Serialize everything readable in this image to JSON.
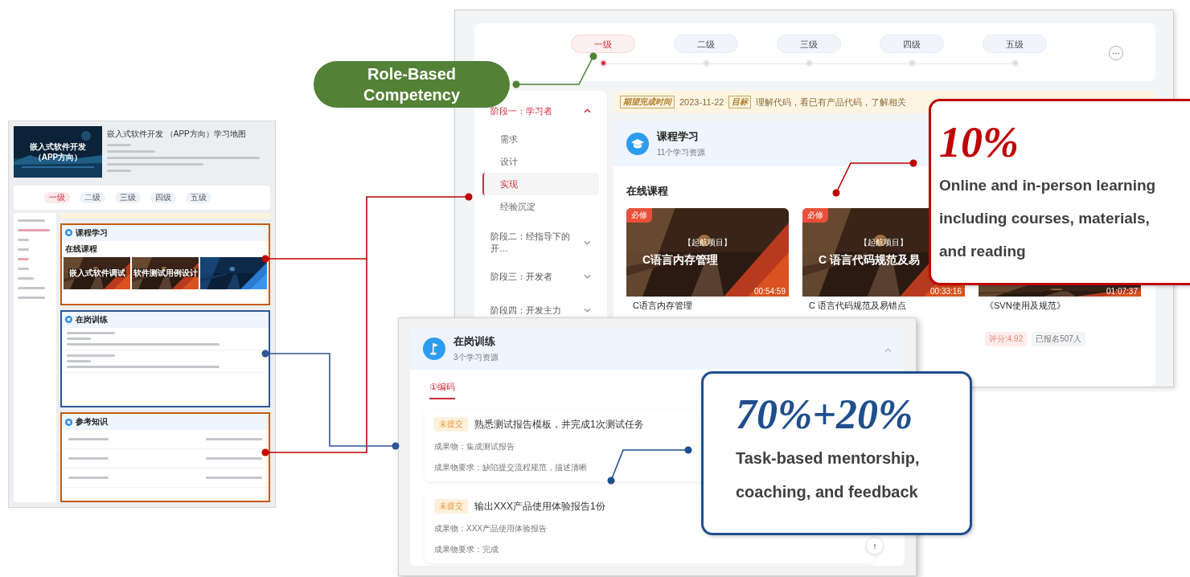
{
  "thumbnail": {
    "banner": [
      "嵌入式软件开发",
      "（APP方向）"
    ],
    "title": "嵌入式软件开发 （APP方向）学习地图",
    "levels": [
      {
        "label": "一级",
        "selected": true
      },
      {
        "label": "二级",
        "selected": false
      },
      {
        "label": "三级",
        "selected": false
      },
      {
        "label": "四级",
        "selected": false
      },
      {
        "label": "五级",
        "selected": false
      }
    ],
    "sections": [
      {
        "kind": "courses",
        "title": "课程学习",
        "heading": "在线课程",
        "color": "#c55a11",
        "cards": [
          {
            "overlay": "嵌入式软件调试"
          },
          {
            "overlay": "软件测试用例设计"
          },
          {
            "kind": "picture"
          }
        ]
      },
      {
        "kind": "training",
        "title": "在岗训练",
        "color": "#2f5597"
      },
      {
        "kind": "reference",
        "title": "参考知识",
        "color": "#c55a11"
      }
    ]
  },
  "role_label": {
    "lines": [
      "Role-Based",
      "Competency"
    ]
  },
  "learning_map": {
    "levels": [
      {
        "label": "一级",
        "selected": true
      },
      {
        "label": "二级",
        "selected": false
      },
      {
        "label": "三级",
        "selected": false
      },
      {
        "label": "四级",
        "selected": false
      },
      {
        "label": "五级",
        "selected": false
      }
    ],
    "stages": [
      {
        "label": "阶段一：学习者",
        "selected": true,
        "expanded": true,
        "children": [
          {
            "label": "需求",
            "selected": false
          },
          {
            "label": "设计",
            "selected": false
          },
          {
            "label": "实现",
            "selected": true
          },
          {
            "label": "经验沉淀",
            "selected": false
          }
        ]
      },
      {
        "label": "阶段二：经指导下的开…",
        "selected": false,
        "expanded": false
      },
      {
        "label": "阶段三：开发者",
        "selected": false,
        "expanded": false
      },
      {
        "label": "阶段四：开发主力",
        "selected": false,
        "expanded": false
      }
    ],
    "notice": {
      "deadline_tag": "期望完成时间",
      "deadline": "2023-11-22",
      "goal_tag": "目标",
      "goal": "理解代码，看已有产品代码，了解相关"
    },
    "course_section": {
      "title": "课程学习",
      "subtitle": "11个学习资源",
      "heading": "在线课程",
      "courses": [
        {
          "badge": "必修",
          "series": "【起航项目】",
          "overlay": "C语言内存管理",
          "duration": "00:54:59",
          "name": "C语言内存管理"
        },
        {
          "badge": "必修",
          "series": "【起航项目】",
          "overlay": "C 语言代码规范及易",
          "duration": "00:33:16",
          "name": "C 语言代码规范及易错点"
        },
        {
          "duration": "01:07:37",
          "name": "《SVN使用及规范》",
          "rating": "评分:4.92",
          "enrolled": "已报名507人"
        }
      ]
    }
  },
  "training_panel": {
    "title": "在岗训练",
    "subtitle": "3个学习资源",
    "tabs": [
      {
        "label": "①编码",
        "selected": true
      }
    ],
    "tasks": [
      {
        "status": "未提交",
        "title": "熟悉测试报告模板，并完成1次测试任务",
        "deliverable": "成果物：集成测试报告",
        "requirement": "成果物要求：缺陷提交流程规范，描述清晰"
      },
      {
        "status": "未提交",
        "title": "输出XXX产品使用体验报告1份",
        "deliverable": "成果物：XXX产品使用体验报告",
        "requirement": "成果物要求：完成"
      }
    ],
    "back_to_top": "↑"
  },
  "callouts": [
    {
      "kind": "red",
      "headline": "10%",
      "lines": [
        "Online and in-person learning",
        "including courses, materials,",
        "and reading"
      ]
    },
    {
      "kind": "blue",
      "headline": "70%+20%",
      "lines": [
        "Task-based mentorship,",
        "coaching, and feedback"
      ]
    }
  ]
}
